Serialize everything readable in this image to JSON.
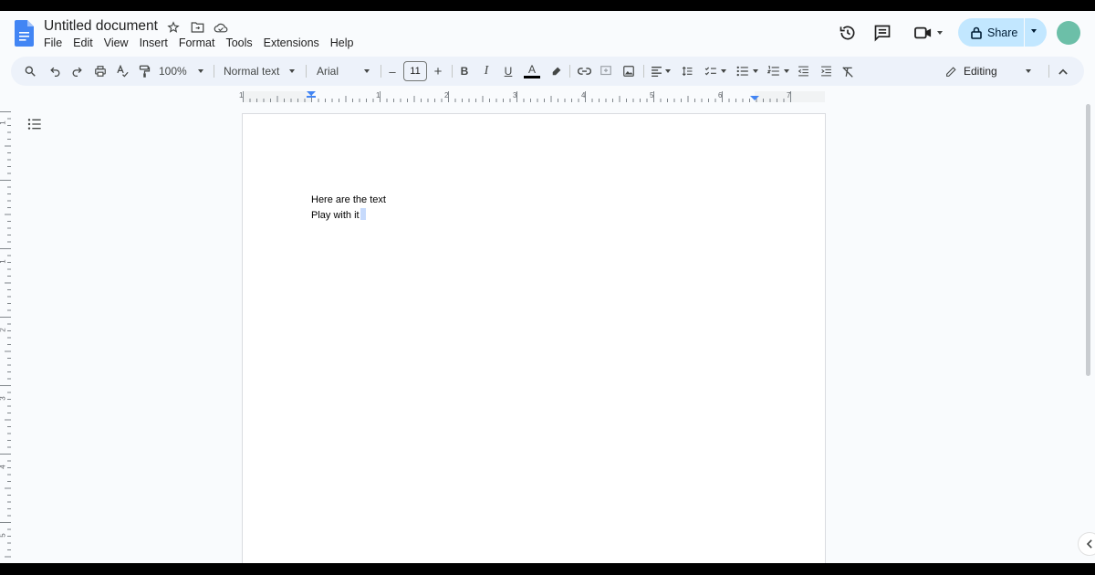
{
  "document": {
    "title": "Untitled document"
  },
  "menu": [
    "File",
    "Edit",
    "View",
    "Insert",
    "Format",
    "Tools",
    "Extensions",
    "Help"
  ],
  "toolbar": {
    "zoom": "100%",
    "paragraph_style": "Normal text",
    "font": "Arial",
    "font_size": "11",
    "bold": "B",
    "italic": "I",
    "underline": "U",
    "text_color": "A",
    "decrease_font": "–",
    "increase_font": "+",
    "mode": "Editing"
  },
  "header": {
    "share_label": "Share"
  },
  "ruler": {
    "horizontal_labels": [
      "1",
      "1",
      "2",
      "3",
      "4",
      "5",
      "6",
      "7"
    ],
    "vertical_labels": [
      "1",
      "1",
      "2",
      "3",
      "4",
      "5"
    ]
  },
  "content": {
    "line1": "Here are the text",
    "line2": "Play with it"
  },
  "colors": {
    "accent": "#1a73e8",
    "share_bg": "#c2e7ff",
    "toolbar_bg": "#edf2fa",
    "avatar": "#6cbfa8",
    "selection": "#c6dafc"
  }
}
